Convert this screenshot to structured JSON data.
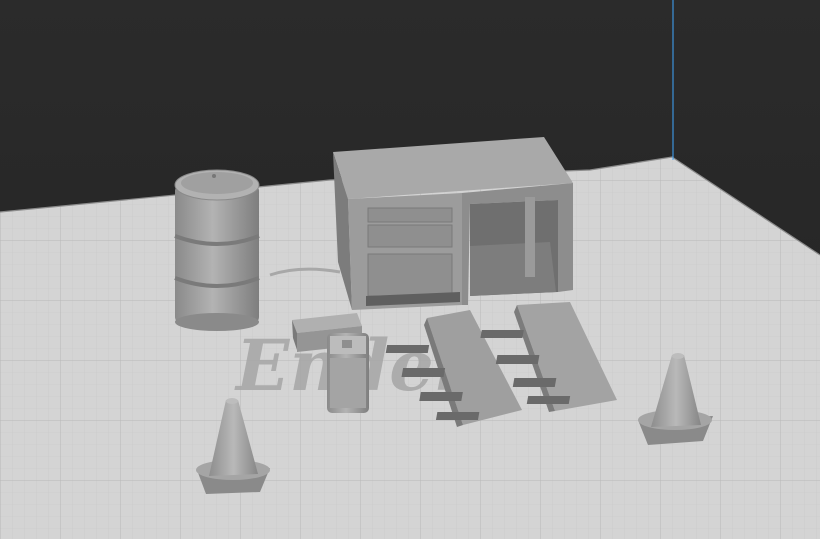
{
  "viewport": {
    "background_color": "#262626",
    "bed_color": "#d4d4d4",
    "grid_line_color": "#bdbdbd",
    "model_color": "#9a9a9a",
    "axis_line_color": "#3fa7ff"
  },
  "bed": {
    "logo_text": "Ender"
  },
  "objects": [
    {
      "name": "oil-drum"
    },
    {
      "name": "workbench"
    },
    {
      "name": "toolbox-small"
    },
    {
      "name": "jerry-can"
    },
    {
      "name": "car-ramp-left"
    },
    {
      "name": "car-ramp-right"
    },
    {
      "name": "traffic-cone-left"
    },
    {
      "name": "traffic-cone-right"
    }
  ]
}
